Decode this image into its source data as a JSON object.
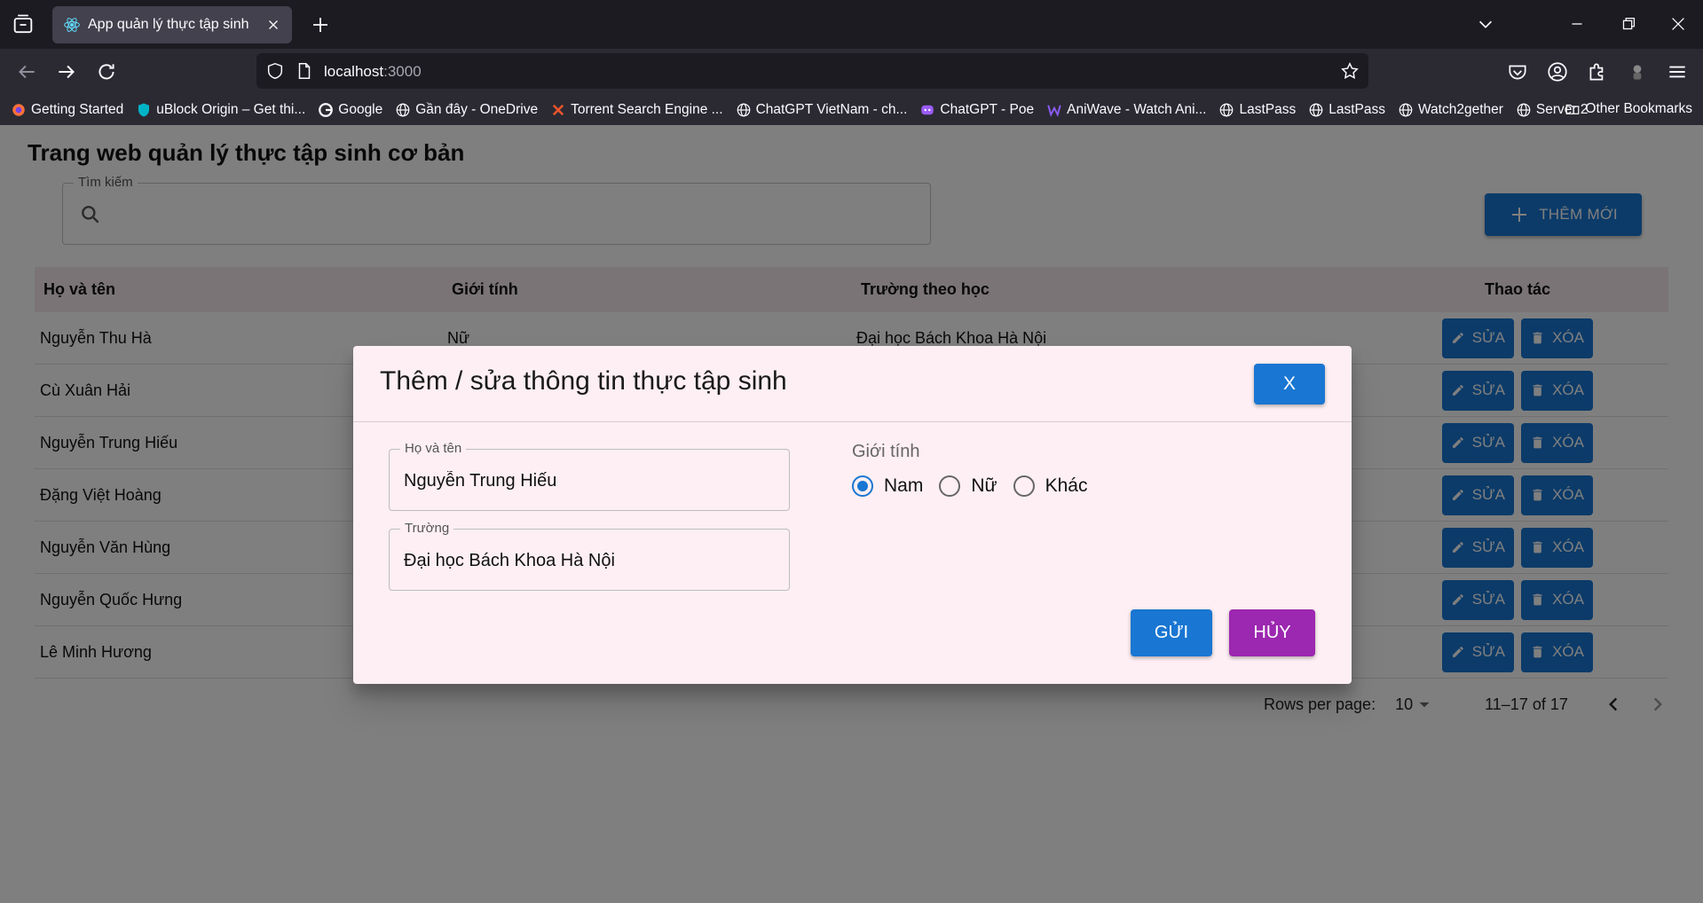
{
  "browser": {
    "tab_title": "App quản lý thực tập sinh",
    "url_host": "localhost",
    "url_port": ":3000",
    "bookmarks": [
      {
        "label": "Getting Started",
        "icon": "firefox-icon"
      },
      {
        "label": "uBlock Origin – Get thi...",
        "icon": "ublock-icon"
      },
      {
        "label": "Google",
        "icon": "google-icon"
      },
      {
        "label": "Gần đây - OneDrive",
        "icon": "globe-icon"
      },
      {
        "label": "Torrent Search Engine ...",
        "icon": "torrent-icon"
      },
      {
        "label": "ChatGPT VietNam - ch...",
        "icon": "globe-icon"
      },
      {
        "label": "ChatGPT - Poe",
        "icon": "poe-icon"
      },
      {
        "label": "AniWave - Watch Ani...",
        "icon": "aniwave-icon"
      },
      {
        "label": "LastPass",
        "icon": "globe-icon"
      },
      {
        "label": "LastPass",
        "icon": "globe-icon"
      },
      {
        "label": "Watch2gether",
        "icon": "globe-icon"
      },
      {
        "label": "Server 2",
        "icon": "globe-icon"
      }
    ],
    "other_bookmarks": "Other Bookmarks"
  },
  "page": {
    "title": "Trang web quản lý thực tập sinh cơ bản",
    "search_legend": "Tìm kiếm",
    "add_button": "THÊM MỚI",
    "columns": [
      "Họ và tên",
      "Giới tính",
      "Trường theo học",
      "Thao tác"
    ],
    "rows": [
      {
        "name": "Nguyễn Thu Hà",
        "gender": "Nữ",
        "school": "Đại học Bách Khoa Hà Nội"
      },
      {
        "name": "Cù Xuân Hải",
        "gender": "",
        "school": ""
      },
      {
        "name": "Nguyễn Trung Hiếu",
        "gender": "",
        "school": ""
      },
      {
        "name": "Đặng Việt Hoàng",
        "gender": "",
        "school": ""
      },
      {
        "name": "Nguyễn Văn Hùng",
        "gender": "",
        "school": ""
      },
      {
        "name": "Nguyễn Quốc Hưng",
        "gender": "",
        "school": ""
      },
      {
        "name": "Lê Minh Hương",
        "gender": "",
        "school": ""
      }
    ],
    "edit_label": "SỬA",
    "delete_label": "XÓA",
    "pagination": {
      "rows_per_page_label": "Rows per page:",
      "rows_per_page": "10",
      "range": "11–17 of 17"
    }
  },
  "dialog": {
    "title": "Thêm / sửa thông tin thực tập sinh",
    "close_label": "X",
    "name_legend": "Họ và tên",
    "name_value": "Nguyễn Trung Hiếu",
    "school_legend": "Trường",
    "school_value": "Đại học Bách Khoa Hà Nội",
    "gender_label": "Giới tính",
    "gender_options": [
      "Nam",
      "Nữ",
      "Khác"
    ],
    "gender_selected": "Nam",
    "submit_label": "GỬI",
    "cancel_label": "HỦY"
  },
  "colors": {
    "primary": "#1976d2",
    "secondary": "#9c27b0",
    "dialog_bg": "#fdeff3",
    "header_bg": "#f5e9ee"
  }
}
